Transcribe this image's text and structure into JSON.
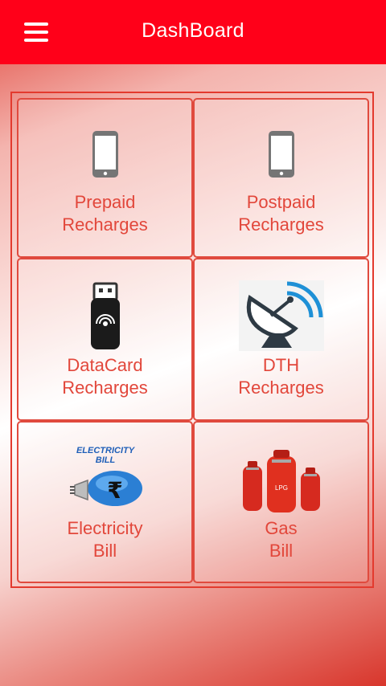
{
  "appbar": {
    "title": "DashBoard",
    "background": "#ff0019"
  },
  "tiles": [
    {
      "line1": "Prepaid",
      "line2": "Recharges",
      "icon": "mobile-phone-icon"
    },
    {
      "line1": "Postpaid",
      "line2": "Recharges",
      "icon": "mobile-phone-icon"
    },
    {
      "line1": "DataCard",
      "line2": "Recharges",
      "icon": "usb-datacard-icon"
    },
    {
      "line1": "DTH",
      "line2": "Recharges",
      "icon": "satellite-dish-icon"
    },
    {
      "line1": "Electricity",
      "line2": "Bill",
      "icon": "electricity-bulb-icon",
      "icon_text": "ELECTRICITY BILL"
    },
    {
      "line1": "Gas",
      "line2": "Bill",
      "icon": "gas-cylinders-icon"
    }
  ],
  "colors": {
    "accent": "#ff0019",
    "label": "#e2473b",
    "border": "#e04a3e"
  }
}
